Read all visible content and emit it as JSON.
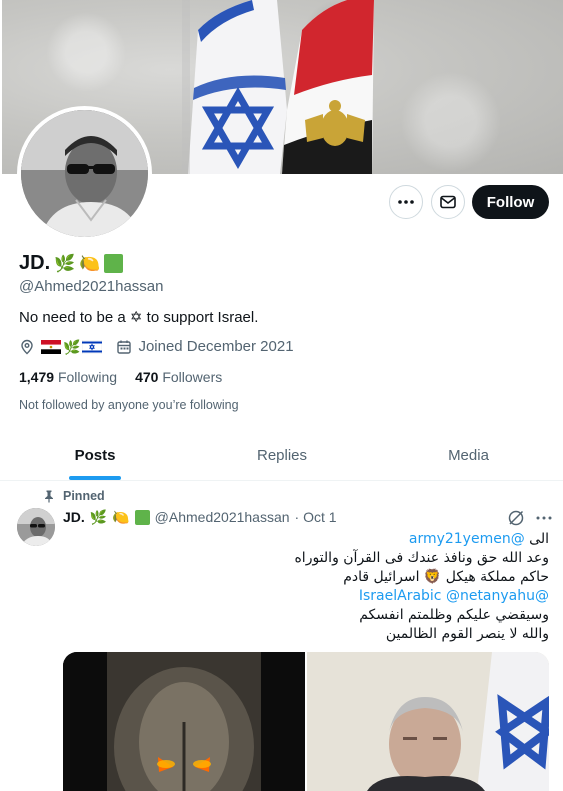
{
  "profile": {
    "display_name": "JD.",
    "handle": "@Ahmed2021hassan",
    "bio": "No need to be a ✡ to support Israel.",
    "joined": "Joined December 2021",
    "following_count": "1,479",
    "following_label": "Following",
    "followers_count": "470",
    "followers_label": "Followers",
    "not_followed": "Not followed by anyone you’re following"
  },
  "actions": {
    "follow_label": "Follow"
  },
  "tabs": [
    {
      "label": "Posts"
    },
    {
      "label": "Replies"
    },
    {
      "label": "Media"
    }
  ],
  "pinned_tweet": {
    "pinned_label": "Pinned",
    "author_name": "JD.",
    "author_handle": "@Ahmed2021hassan",
    "date": "· Oct 1",
    "lines": [
      {
        "prefix": "الى ",
        "link": "@army21yemen"
      },
      {
        "text": "وعد الله حق ونافذ عندك فى القرآن والتوراه"
      },
      {
        "text": "حاكم مملكة هيكل 🦁 اسرائيل قادم"
      },
      {
        "links": "@IsraelArabic @netanyahu"
      },
      {
        "text": "وسيقضي عليكم وظلمتم انفسكم"
      },
      {
        "text": "والله لا ينصر القوم الظالمين"
      }
    ]
  },
  "colors": {
    "accent": "#1d9bf0",
    "text": "#0f1419",
    "muted": "#536471",
    "border": "#cfd9de"
  },
  "icons": [
    "more-icon",
    "mail-icon",
    "location-icon",
    "calendar-icon",
    "pin-icon",
    "grok-icon",
    "olive-branch-icon",
    "lemon-icon",
    "green-square-icon"
  ]
}
